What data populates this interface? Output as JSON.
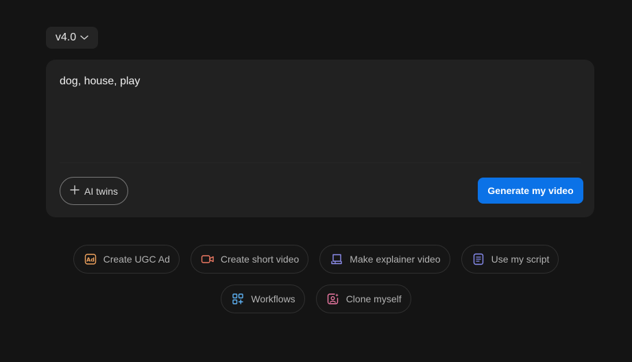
{
  "version_selector": {
    "label": "v4.0",
    "icon": "chevron-down-icon"
  },
  "composer": {
    "prompt_value": "dog, house, play",
    "ai_twins_label": "AI twins",
    "generate_label": "Generate my video"
  },
  "quick_actions": [
    {
      "label": "Create UGC Ad",
      "icon": "ad-icon",
      "color": "#f0a35e"
    },
    {
      "label": "Create short video",
      "icon": "video-camera-icon",
      "color": "#f07a63"
    },
    {
      "label": "Make explainer video",
      "icon": "presentation-icon",
      "color": "#8f8ff0"
    },
    {
      "label": "Use my script",
      "icon": "document-icon",
      "color": "#8a8ff5"
    },
    {
      "label": "Workflows",
      "icon": "workflow-grid-icon",
      "color": "#5fb3f5"
    },
    {
      "label": "Clone myself",
      "icon": "clone-user-icon",
      "color": "#f07aa6"
    }
  ]
}
